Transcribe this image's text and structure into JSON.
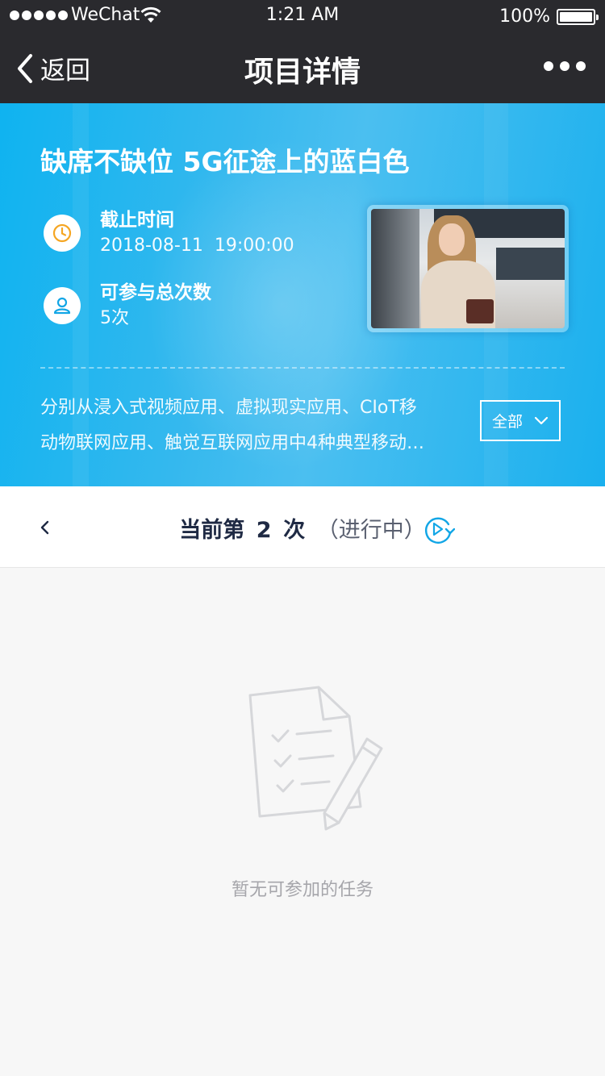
{
  "status_bar": {
    "carrier": "WeChat",
    "time": "1:21 AM",
    "battery": "100%"
  },
  "nav": {
    "back_label": "返回",
    "title": "项目详情"
  },
  "hero": {
    "title": "缺席不缺位 5G征途上的蓝白色",
    "deadline_label": "截止时间",
    "deadline_value": "2018-08-11  19:00:00",
    "participation_label": "可参与总次数",
    "participation_value": "5次",
    "description_line1": "分别从浸入式视频应用、虚拟现实应用、CIoT移",
    "description_line2": "动物联网应用、触觉互联网应用中4种典型移动…",
    "all_button": "全部"
  },
  "round": {
    "prefix": "当前第",
    "number": "2",
    "suffix": "次",
    "status": "（进行中）"
  },
  "empty": {
    "message": "暂无可参加的任务"
  },
  "colors": {
    "accent_blue": "#12b2ee",
    "dark_bar": "#2a2a2e",
    "clock_orange": "#f5a623",
    "user_blue": "#12a6e6"
  },
  "icons": {
    "clock": "clock-icon",
    "user": "user-icon",
    "refresh": "refresh-play-icon",
    "empty": "checklist-pencil-icon"
  }
}
